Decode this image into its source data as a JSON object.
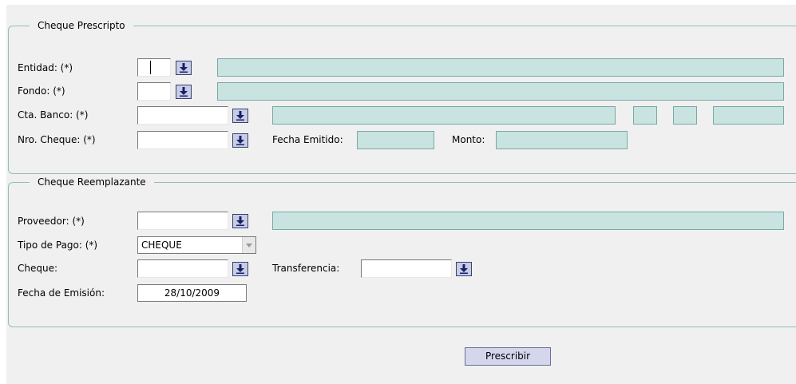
{
  "prescripto": {
    "title": "Cheque Prescripto",
    "entidad_label": "Entidad: (*)",
    "fondo_label": "Fondo: (*)",
    "cta_banco_label": "Cta. Banco: (*)",
    "nro_cheque_label": "Nro. Cheque: (*)",
    "fecha_emitido_label": "Fecha Emitido:",
    "monto_label": "Monto:"
  },
  "reemplazante": {
    "title": "Cheque Reemplazante",
    "proveedor_label": "Proveedor: (*)",
    "tipo_pago_label": "Tipo de Pago: (*)",
    "tipo_pago_value": "CHEQUE",
    "cheque_label": "Cheque:",
    "transferencia_label": "Transferencia:",
    "fecha_emision_label": "Fecha de Emisión:",
    "fecha_emision_value": "28/10/2009"
  },
  "actions": {
    "prescribir_label": "Prescribir"
  },
  "icons": {
    "lov": "download-arrow-icon",
    "dropdown": "chevron-down-icon"
  },
  "colors": {
    "readonly_fill": "#c9e3e1",
    "lov_button": "#c7cde3",
    "frame": "#8fbfb8",
    "background": "#f0f0f0"
  }
}
